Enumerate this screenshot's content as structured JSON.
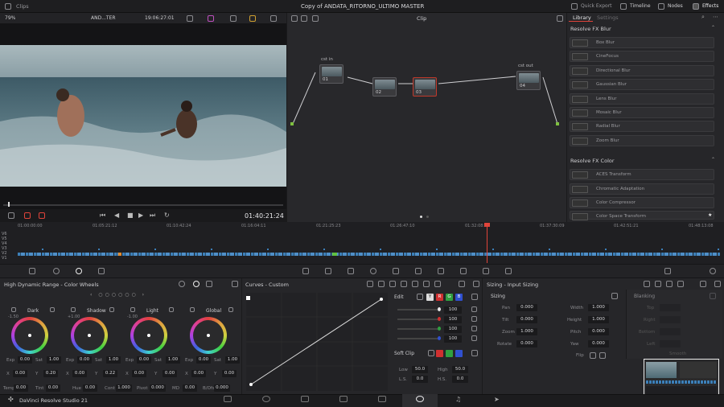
{
  "titlebar": {
    "clips_label": "Clips",
    "project_title": "Copy of ANDATA_RITORNO_ULTIMO MASTER",
    "quick_export": "Quick Export",
    "timeline": "Timeline",
    "nodes": "Nodes",
    "effects": "Effects"
  },
  "viewer": {
    "zoom": "79%",
    "clip_name": "AND...TER",
    "timecode_top": "19:06:27:01",
    "timecode_bottom": "01:40:21:24"
  },
  "node_editor": {
    "mode": "Clip",
    "nodes": [
      {
        "label": "cst in",
        "num": "01"
      },
      {
        "num": "02"
      },
      {
        "num": "03"
      },
      {
        "label": "cst out",
        "num": "04"
      }
    ]
  },
  "library": {
    "tab_library": "Library",
    "tab_settings": "Settings",
    "section_blur": "Resolve FX Blur",
    "blur_items": [
      "Box Blur",
      "CineFocus",
      "Directional Blur",
      "Gaussian Blur",
      "Lens Blur",
      "Mosaic Blur",
      "Radial Blur",
      "Zoom Blur"
    ],
    "section_color": "Resolve FX Color",
    "color_items": [
      "ACES Transform",
      "Chromatic Adaptation",
      "Color Compressor",
      "Color Space Transform"
    ]
  },
  "timeline": {
    "tracks": [
      "V6",
      "V5",
      "V4",
      "V3",
      "V2",
      "V1"
    ],
    "ruler": [
      "01:00:00:00",
      "01:05:21:12",
      "01:10:42:24",
      "01:16:04:11",
      "01:21:25:23",
      "01:26:47:10",
      "01:32:08:22",
      "01:37:30:09",
      "01:42:51:21",
      "01:48:13:08"
    ],
    "playhead_fraction": 0.68
  },
  "color_wheels": {
    "title": "High Dynamic Range - Color Wheels",
    "wheels": [
      {
        "name": "Dark",
        "exp_label": "Exp",
        "exp": "0.00",
        "sat_label": "Sat",
        "sat": "1.00",
        "stop": "-1.50",
        "x": "0.00",
        "y": "0.20"
      },
      {
        "name": "Shadow",
        "exp_label": "Exp",
        "exp": "0.00",
        "sat_label": "Sat",
        "sat": "1.00",
        "stop": "+1.00",
        "x": "0.00",
        "y": "0.22"
      },
      {
        "name": "Light",
        "exp_label": "Exp",
        "exp": "0.00",
        "sat_label": "Sat",
        "sat": "1.00",
        "stop": "-1.00",
        "x": "0.00",
        "y": "0.00"
      },
      {
        "name": "Global",
        "exp_label": "Exp",
        "exp": "0.00",
        "sat_label": "Sat",
        "sat": "1.00",
        "stop": "",
        "x": "0.00",
        "y": "0.00"
      }
    ],
    "bottom": {
      "temp_label": "Temp",
      "temp": "0.00",
      "tint_label": "Tint",
      "tint": "0.00",
      "hue_label": "Hue",
      "hue": "0.00",
      "cont_label": "Cont",
      "cont": "1.000",
      "pivot_label": "Pivot",
      "pivot": "0.000",
      "md_label": "MD",
      "md": "0.00",
      "bofs_label": "B/Ofs",
      "bofs": "0.000"
    }
  },
  "curves": {
    "title": "Curves - Custom",
    "edit_label": "Edit",
    "channels": [
      "Y",
      "R",
      "G",
      "B"
    ],
    "values": [
      "100",
      "100",
      "100",
      "100"
    ],
    "soft_clip": "Soft Clip",
    "low_label": "Low",
    "low": "50.0",
    "high_label": "High",
    "high": "50.0",
    "ls_label": "L.S.",
    "ls": "0.0",
    "hs_label": "H.S.",
    "hs": "0.0"
  },
  "sizing": {
    "title": "Sizing - Input Sizing",
    "section": "Sizing",
    "pan_label": "Pan",
    "pan": "0.000",
    "tilt_label": "Tilt",
    "tilt": "0.000",
    "zoom_label": "Zoom",
    "zoom": "1.000",
    "rotate_label": "Rotate",
    "rotate": "0.000",
    "width_label": "Width",
    "width": "1.000",
    "height_label": "Height",
    "height": "1.000",
    "pitch_label": "Pitch",
    "pitch": "0.000",
    "yaw_label": "Yaw",
    "yaw": "0.000",
    "flip_label": "Flip",
    "blanking": "Blanking",
    "top": "Top",
    "right": "Right",
    "bottom": "Bottom",
    "left": "Left",
    "smooth": "Smooth"
  },
  "footer": {
    "app_name": "DaVinci Resolve Studio 21"
  },
  "colors": {
    "accent": "#e0443a",
    "playhead": "#e0443a",
    "node_selected": "#c0392b"
  }
}
